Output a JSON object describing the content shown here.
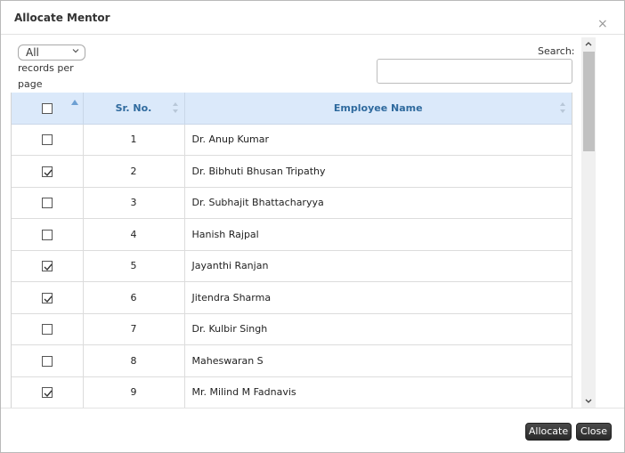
{
  "dialog": {
    "title": "Allocate Mentor",
    "close_glyph": "×"
  },
  "controls": {
    "length_value": "All",
    "length_label": "records per page",
    "search_label": "Search:",
    "search_value": ""
  },
  "table": {
    "columns": [
      "",
      "Sr. No.",
      "Employee Name"
    ],
    "rows": [
      {
        "checked": false,
        "sr": "1",
        "name": "Dr. Anup Kumar"
      },
      {
        "checked": true,
        "sr": "2",
        "name": "Dr. Bibhuti Bhusan Tripathy"
      },
      {
        "checked": false,
        "sr": "3",
        "name": "Dr. Subhajit Bhattacharyya"
      },
      {
        "checked": false,
        "sr": "4",
        "name": "Hanish Rajpal"
      },
      {
        "checked": true,
        "sr": "5",
        "name": "Jayanthi Ranjan"
      },
      {
        "checked": true,
        "sr": "6",
        "name": "Jitendra Sharma"
      },
      {
        "checked": false,
        "sr": "7",
        "name": "Dr. Kulbir Singh"
      },
      {
        "checked": false,
        "sr": "8",
        "name": "Maheswaran S"
      },
      {
        "checked": true,
        "sr": "9",
        "name": "Mr. Milind M Fadnavis"
      }
    ]
  },
  "footer": {
    "allocate_label": "Allocate",
    "close_label": "Close"
  },
  "colors": {
    "header_bg": "#dbe9fa",
    "header_text": "#2f6a9e",
    "button_bg": "#333333"
  }
}
